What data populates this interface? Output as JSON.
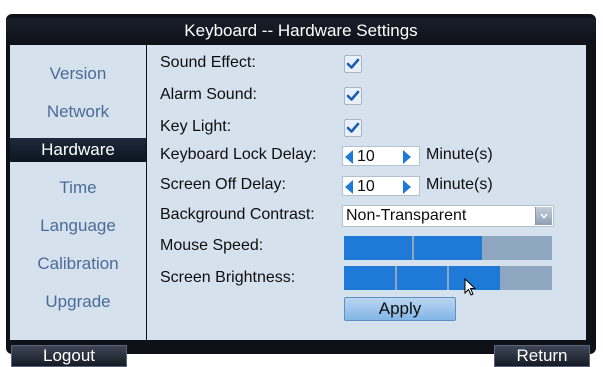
{
  "window": {
    "title": "Keyboard -- Hardware Settings"
  },
  "sidebar": {
    "items": [
      {
        "label": "Version",
        "active": false
      },
      {
        "label": "Network",
        "active": false
      },
      {
        "label": "Hardware",
        "active": true
      },
      {
        "label": "Time",
        "active": false
      },
      {
        "label": "Language",
        "active": false
      },
      {
        "label": "Calibration",
        "active": false
      },
      {
        "label": "Upgrade",
        "active": false
      }
    ]
  },
  "settings": {
    "sound_effect": {
      "label": "Sound Effect:",
      "checked": true
    },
    "alarm_sound": {
      "label": "Alarm Sound:",
      "checked": true
    },
    "key_light": {
      "label": "Key Light:",
      "checked": true
    },
    "keyboard_lock_delay": {
      "label": "Keyboard Lock Delay:",
      "value": "10",
      "unit": "Minute(s)"
    },
    "screen_off_delay": {
      "label": "Screen Off Delay:",
      "value": "10",
      "unit": "Minute(s)"
    },
    "background_contrast": {
      "label": "Background Contrast:",
      "value": "Non-Transparent"
    },
    "mouse_speed": {
      "label": "Mouse Speed:",
      "level": 2,
      "max": 3
    },
    "screen_brightness": {
      "label": "Screen Brightness:",
      "level": 3,
      "max": 4
    }
  },
  "buttons": {
    "apply": "Apply",
    "logout": "Logout",
    "return": "Return"
  },
  "colors": {
    "accent": "#1e7ad6",
    "panel": "#d6e1ee",
    "sidebar_text": "#4a6c97",
    "frame": "#0e1118"
  },
  "icons": {
    "check": "checkmark-icon",
    "dropdown": "chevron-down-icon",
    "cursor": "mouse-pointer-icon"
  }
}
